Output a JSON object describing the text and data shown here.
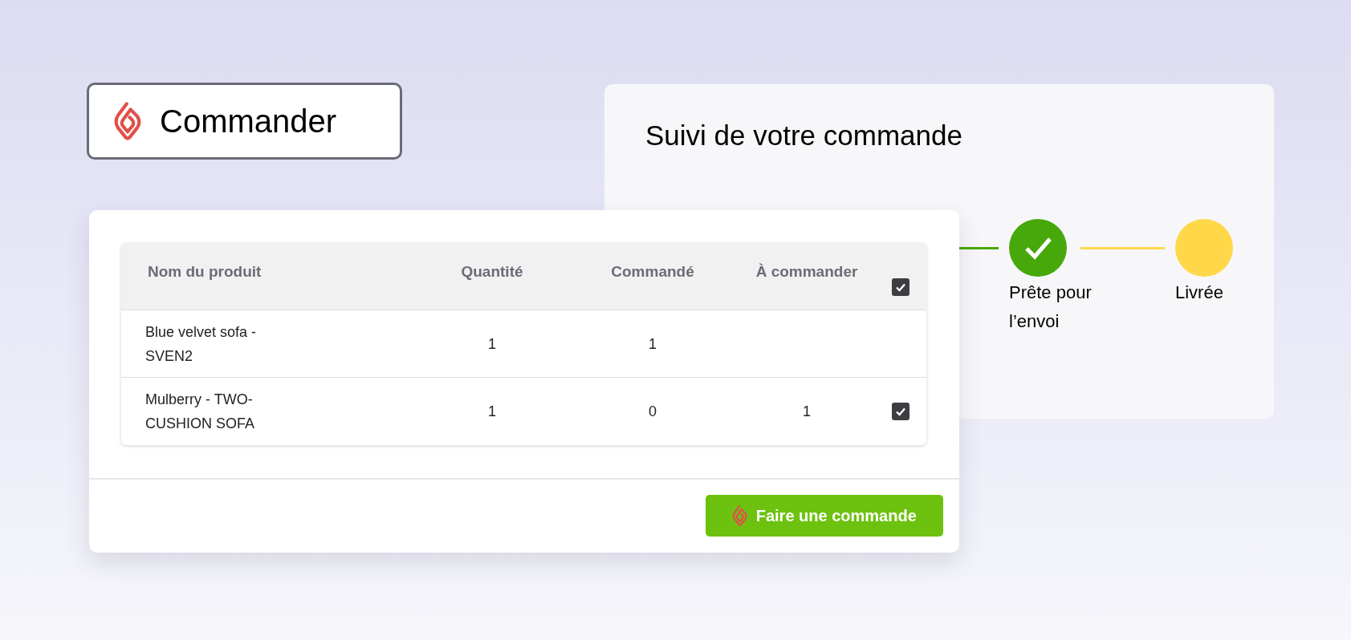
{
  "order_button": {
    "label": "Commander"
  },
  "tracking": {
    "title": "Suivi de votre commande",
    "steps": [
      {
        "label": "Prête pour l’envoi",
        "done": true
      },
      {
        "label": "Livrée",
        "done": false
      }
    ]
  },
  "table": {
    "columns": [
      "Nom du produit",
      "Quantité",
      "Commandé",
      "À commander"
    ],
    "select_all_checked": true,
    "rows": [
      {
        "cells": [
          "Blue velvet sofa - SVEN2",
          "1",
          "1",
          ""
        ]
      },
      {
        "cells": [
          "Mulberry - TWO-CUSHION SOFA",
          "1",
          "0",
          "1"
        ],
        "checked": true
      }
    ]
  },
  "place_order_button": {
    "label": "Faire une commande"
  }
}
